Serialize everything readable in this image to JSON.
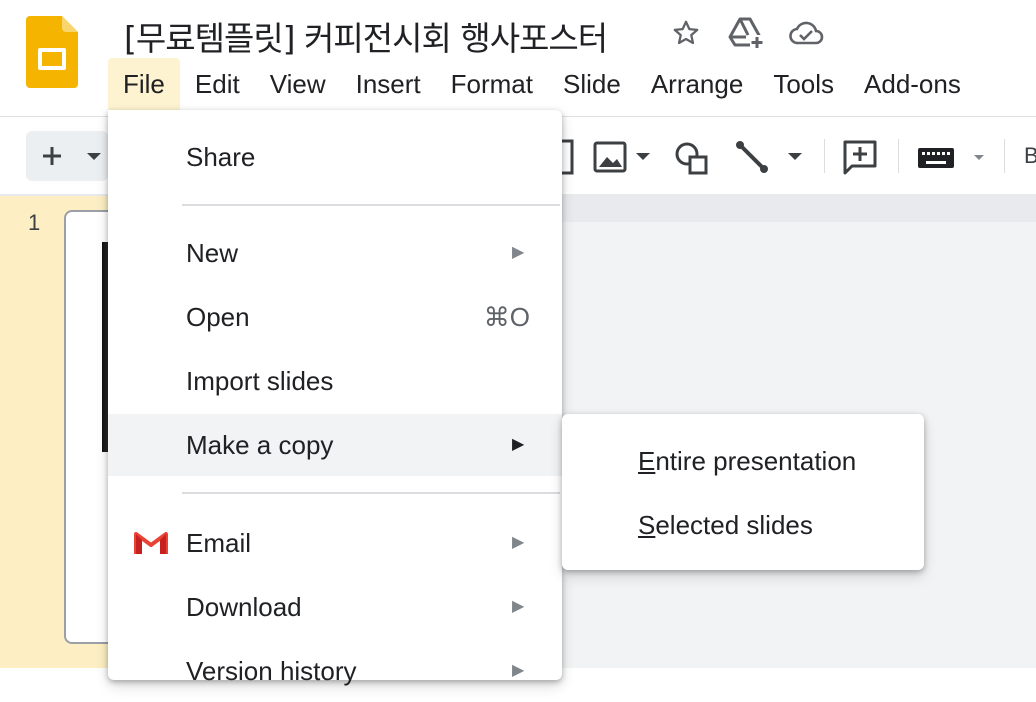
{
  "doc": {
    "title": "[무료템플릿] 커피전시회 행사포스터"
  },
  "menubar": {
    "items": [
      "File",
      "Edit",
      "View",
      "Insert",
      "Format",
      "Slide",
      "Arrange",
      "Tools",
      "Add-ons"
    ],
    "active": "File"
  },
  "toolbar": {
    "truncated_label": "B"
  },
  "filmstrip": {
    "slide_number": "1"
  },
  "file_menu": {
    "share": "Share",
    "new": "New",
    "open": "Open",
    "open_shortcut": "⌘O",
    "import_slides": "Import slides",
    "make_a_copy": "Make a copy",
    "email": "Email",
    "download": "Download",
    "version_history": "Version history"
  },
  "copy_submenu": {
    "entire_first": "E",
    "entire_rest": "ntire presentation",
    "selected_first": "S",
    "selected_rest": "elected slides"
  },
  "colors": {
    "slides_yellow": "#f4b400",
    "active_menu_bg": "#fdf3d0",
    "filmstrip_bg": "#fdefc3",
    "gmail_red": "#ea4335"
  }
}
